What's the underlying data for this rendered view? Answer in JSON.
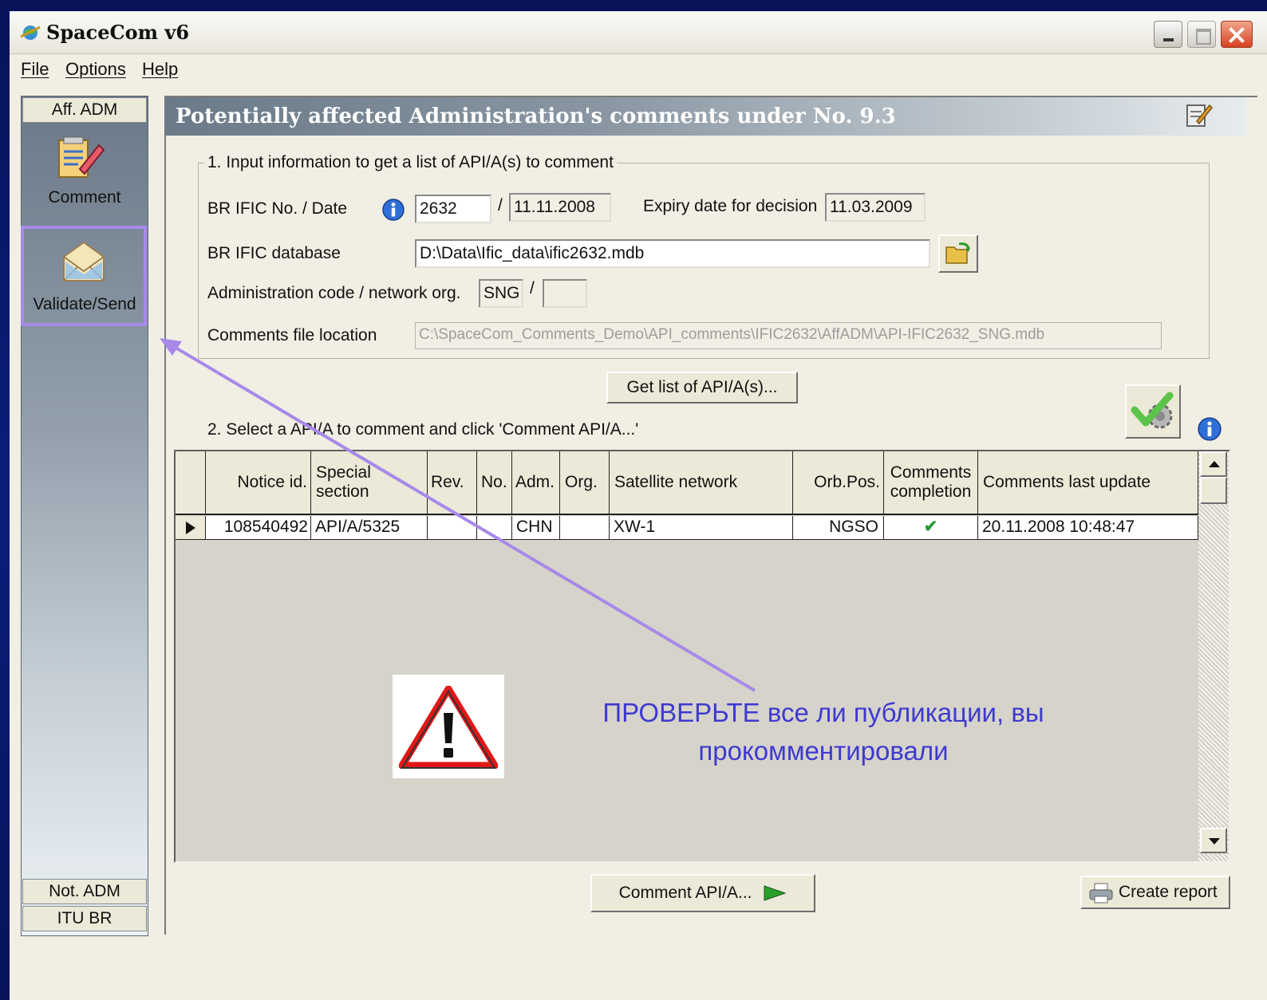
{
  "window": {
    "title": "SpaceCom v6"
  },
  "menu": {
    "file": "File",
    "options": "Options",
    "help": "Help"
  },
  "sidebar": {
    "aff_adm": "Aff. ADM",
    "comment": "Comment",
    "validate_send": "Validate/Send",
    "not_adm": "Not. ADM",
    "itu_br": "ITU BR"
  },
  "header": {
    "title": "Potentially affected Administration's comments under No. 9.3"
  },
  "section1": {
    "legend": "1. Input information to get a list of API/A(s) to comment",
    "ific_label": "BR IFIC No. / Date",
    "ific_no": "2632",
    "slash": "/",
    "ific_date": "11.11.2008",
    "expiry_label": "Expiry date for decision",
    "expiry_date": "11.03.2009",
    "db_label": "BR IFIC database",
    "db_path": "D:\\Data\\Ific_data\\ific2632.mdb",
    "adm_label": "Administration code / network org.",
    "adm_code": "SNG",
    "network_org": "",
    "comments_label": "Comments file location",
    "comments_path": "C:\\SpaceCom_Comments_Demo\\API_comments\\IFIC2632\\AffADM\\API-IFIC2632_SNG.mdb"
  },
  "get_list_button": "Get list of API/A(s)...",
  "section2": {
    "label": "2. Select a API/A to comment and click 'Comment API/A...'"
  },
  "grid": {
    "headers": {
      "notice_id": "Notice id.",
      "special_section": "Special section",
      "rev": "Rev.",
      "no": "No.",
      "adm": "Adm.",
      "org": "Org.",
      "satellite_network": "Satellite network",
      "orb_pos": "Orb.Pos.",
      "comments_completion": "Comments completion",
      "comments_last_update": "Comments last update"
    },
    "rows": [
      {
        "notice_id": "108540492",
        "special_section": "API/A/5325",
        "rev": "",
        "no": "",
        "adm": "CHN",
        "org": "",
        "satellite_network": "XW-1",
        "orb_pos": "NGSO",
        "comments_completion": "✔",
        "comments_last_update": "20.11.2008 10:48:47"
      }
    ]
  },
  "annotation": {
    "text": "ПРОВЕРЬТЕ все ли публикации, вы прокомментировали"
  },
  "footer": {
    "comment_button": "Comment API/A...",
    "create_report_button": "Create report"
  },
  "colors": {
    "annotation": "#3e3ad0",
    "highlight": "#a889e8",
    "header_gradient_start": "#6b7a88"
  }
}
